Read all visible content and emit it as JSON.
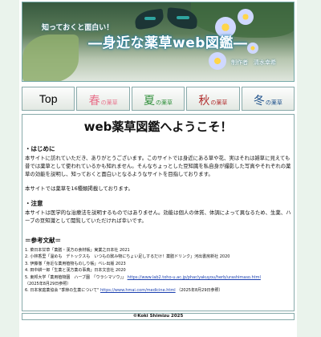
{
  "banner": {
    "kicker": "知っておくと面白い！",
    "title": "―身近な薬草web図鑑―",
    "author": "制作者　清水幸希"
  },
  "nav": [
    {
      "big": "Top",
      "small": "",
      "color": "#000000"
    },
    {
      "big": "春",
      "small": "の薬草",
      "color": "#e8708a"
    },
    {
      "big": "夏",
      "small": "の薬草",
      "color": "#2f8f3a"
    },
    {
      "big": "秋",
      "small": "の薬草",
      "color": "#b02a2a"
    },
    {
      "big": "冬",
      "small": "の薬草",
      "color": "#1c4f8a"
    }
  ],
  "main": {
    "heading": "web薬草図鑑へようこそ！",
    "intro_title": "・はじめに",
    "intro_text": "本サイトに訪れていただき、ありがとうございます。このサイトでは身近にある草や花、実はそれは雑草に見えても昔では薬草として使われているかも知れません。そんなちょっとした豆知識を私自身が撮影した写真やそれぞれの薬草の効能を説明し、知っておくと面白いとなるようなサイトを目指しております。",
    "count_text": "本サイトでは薬草を16種類掲載しております。",
    "note_title": "・注意",
    "note_text": "本サイトは医学的な治療法を説明するものではありません。効能は個人の体質、体調によって異なるため、生薬、ハーブの豆知識として閲覧していただければ幸いです。",
    "refs_title": "＝参考文献＝",
    "refs": [
      {
        "text": "1. 菜日本甘草「薬膳・漢方の食材帳」実業之日本社 2021",
        "link": "",
        "suffix": ""
      },
      {
        "text": "2. 小林香里「温めも　デトックスも　いつもの飲み物にちょい足しするだけ！薬膳ドリンク」河出書房新社 2020",
        "link": "",
        "suffix": ""
      },
      {
        "text": "3. 伊藤徹「身近な薬用植物ものしり帳」ベレ出版 2023",
        "link": "",
        "suffix": ""
      },
      {
        "text": "4. 田中耕一郎「生薬と漢方薬の事典」日本文芸社 2020",
        "link": "",
        "suffix": ""
      },
      {
        "text": "5. 東邦大学「薬用植物園　ハーブ園　「ウラシマソウ」」",
        "link": "https://www.lab2.toho-u.ac.jp/phar/yakuyou/herb/urashimaso.html",
        "suffix": ""
      },
      {
        "text": "（2025年8月29日参照）",
        "link": "",
        "suffix": ""
      },
      {
        "text": "6. 日本家庭薬協会 \"季節の生薬について\"",
        "link": "https://www.hmai.com/medicine.html",
        "suffix": "（2025年8月29日参照）"
      }
    ]
  },
  "footer": {
    "copyright": "©Koki Shimizu 2025"
  }
}
